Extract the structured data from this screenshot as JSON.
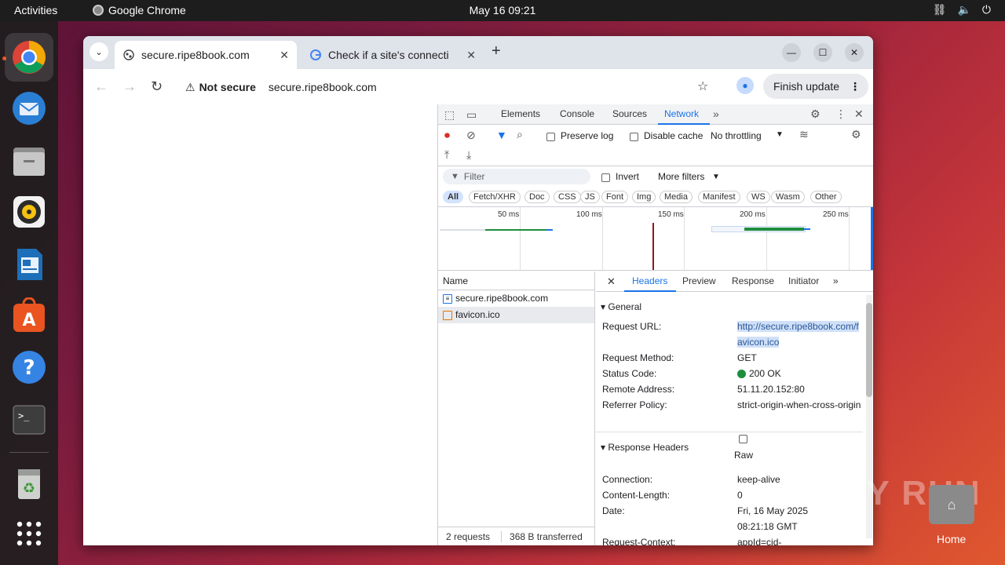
{
  "topbar": {
    "activities": "Activities",
    "app_name": "Google Chrome",
    "clock": "May 16  09:21"
  },
  "dock": {
    "items": [
      "chrome-icon",
      "thunderbird-icon",
      "files-icon",
      "rhythmbox-icon",
      "writer-icon",
      "appcenter-icon",
      "help-icon",
      "terminal-icon",
      "trash-icon",
      "app-grid-icon"
    ]
  },
  "browser": {
    "tabs": [
      {
        "title": "secure.ripe8book.com",
        "active": true
      },
      {
        "title": "Check if a site's connecti",
        "active": false
      }
    ],
    "omnibox": {
      "security_label": "Not secure",
      "url": "secure.ripe8book.com"
    },
    "finish_update": "Finish update"
  },
  "devtools": {
    "tabs": [
      "Elements",
      "Console",
      "Sources",
      "Network"
    ],
    "selected_tab": "Network",
    "preserve_log": "Preserve log",
    "disable_cache": "Disable cache",
    "throttling": "No throttling",
    "filter_placeholder": "Filter",
    "invert": "Invert",
    "more_filters": "More filters",
    "type_filters": [
      "All",
      "Fetch/XHR",
      "Doc",
      "CSS",
      "JS",
      "Font",
      "Img",
      "Media",
      "Manifest",
      "WS",
      "Wasm",
      "Other"
    ],
    "timeline_ticks": [
      "50 ms",
      "100 ms",
      "150 ms",
      "200 ms",
      "250 ms"
    ],
    "name_header": "Name",
    "requests": [
      {
        "name": "secure.ripe8book.com",
        "type": "doc"
      },
      {
        "name": "favicon.ico",
        "type": "img"
      }
    ],
    "footer": {
      "requests": "2 requests",
      "transferred": "368 B transferred"
    },
    "detail_tabs": [
      "Headers",
      "Preview",
      "Response",
      "Initiator"
    ],
    "general": {
      "title": "General",
      "request_url_label": "Request URL:",
      "request_url": "http://secure.ripe8book.com/favicon.ico",
      "method_label": "Request Method:",
      "method": "GET",
      "status_label": "Status Code:",
      "status": "200 OK",
      "remote_label": "Remote Address:",
      "remote": "51.11.20.152:80",
      "referrer_label": "Referrer Policy:",
      "referrer": "strict-origin-when-cross-origin"
    },
    "response_headers": {
      "title": "Response Headers",
      "raw": "Raw",
      "connection_label": "Connection:",
      "connection": "keep-alive",
      "content_length_label": "Content-Length:",
      "content_length": "0",
      "date_label": "Date:",
      "date": "Fri, 16 May 2025 08:21:18 GMT",
      "request_context_label": "Request-Context:",
      "request_context": "appId=cid-"
    },
    "colors": {
      "accent": "#1a73e8",
      "status_ok": "#1e8e3e"
    }
  },
  "desktop": {
    "watermark": "ANY RUN",
    "home_label": "Home"
  }
}
